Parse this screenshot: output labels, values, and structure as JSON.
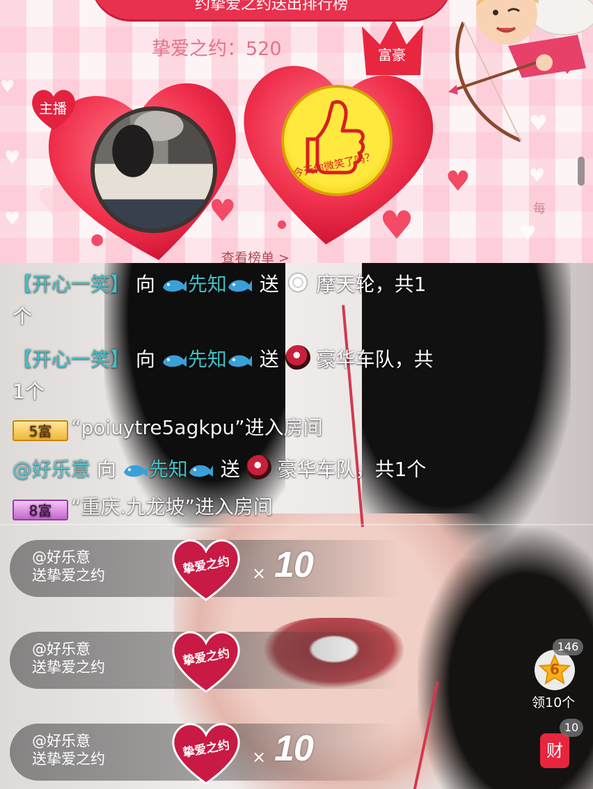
{
  "banner": {
    "title_partial": "约挚爱之约送出排行榜",
    "love_count": "挚爱之约：520",
    "host_tag": "主播",
    "rich_tag": "富豪",
    "rich_motto": "今天你微笑了吗？",
    "view_rank": "查看榜单 >",
    "side_char": "每"
  },
  "chat": {
    "line1": {
      "name": "【开心一笑】",
      "to": "向",
      "target": "先知",
      "send": "送",
      "gift": "摩天轮，共1",
      "cont": "个"
    },
    "line2": {
      "name": "【开心一笑】",
      "to": "向",
      "target": "先知",
      "send": "送",
      "gift": "豪华车队，共",
      "cont": "1个"
    },
    "line3": {
      "level": "5富",
      "text": "“poiuytre5agkpu”进入房间"
    },
    "line4": {
      "name": "@好乐意",
      "to": "向",
      "target": "先知",
      "send": "送",
      "gift": "豪华车队，共1个"
    },
    "line5": {
      "level": "8富",
      "text": "“重庆.九龙坡”进入房间"
    }
  },
  "side": {
    "star_level": "6",
    "star_count": "146",
    "star_label": "领10个",
    "cai_label": "财",
    "cai_count": "10"
  },
  "gifts": [
    {
      "sender": "@好乐意",
      "action": "送挚爱之约",
      "gift_text": "挚爱之约",
      "x": "×",
      "count": "10"
    },
    {
      "sender": "@好乐意",
      "action": "送挚爱之约",
      "gift_text": "挚爱之约",
      "x": "",
      "count": ""
    },
    {
      "sender": "@好乐意",
      "action": "送挚爱之约",
      "gift_text": "挚爱之约",
      "x": "×",
      "count": "10"
    }
  ],
  "colors": {
    "accent_red": "#e8314f",
    "chat_name": "#40c0c8",
    "banner_bg": "#fbe9ee"
  },
  "icons": [
    "whale-icon",
    "ferris-wheel-icon",
    "car-icon",
    "star-badge-icon",
    "heart-icon",
    "thumbs-up-icon",
    "cupid-icon"
  ]
}
